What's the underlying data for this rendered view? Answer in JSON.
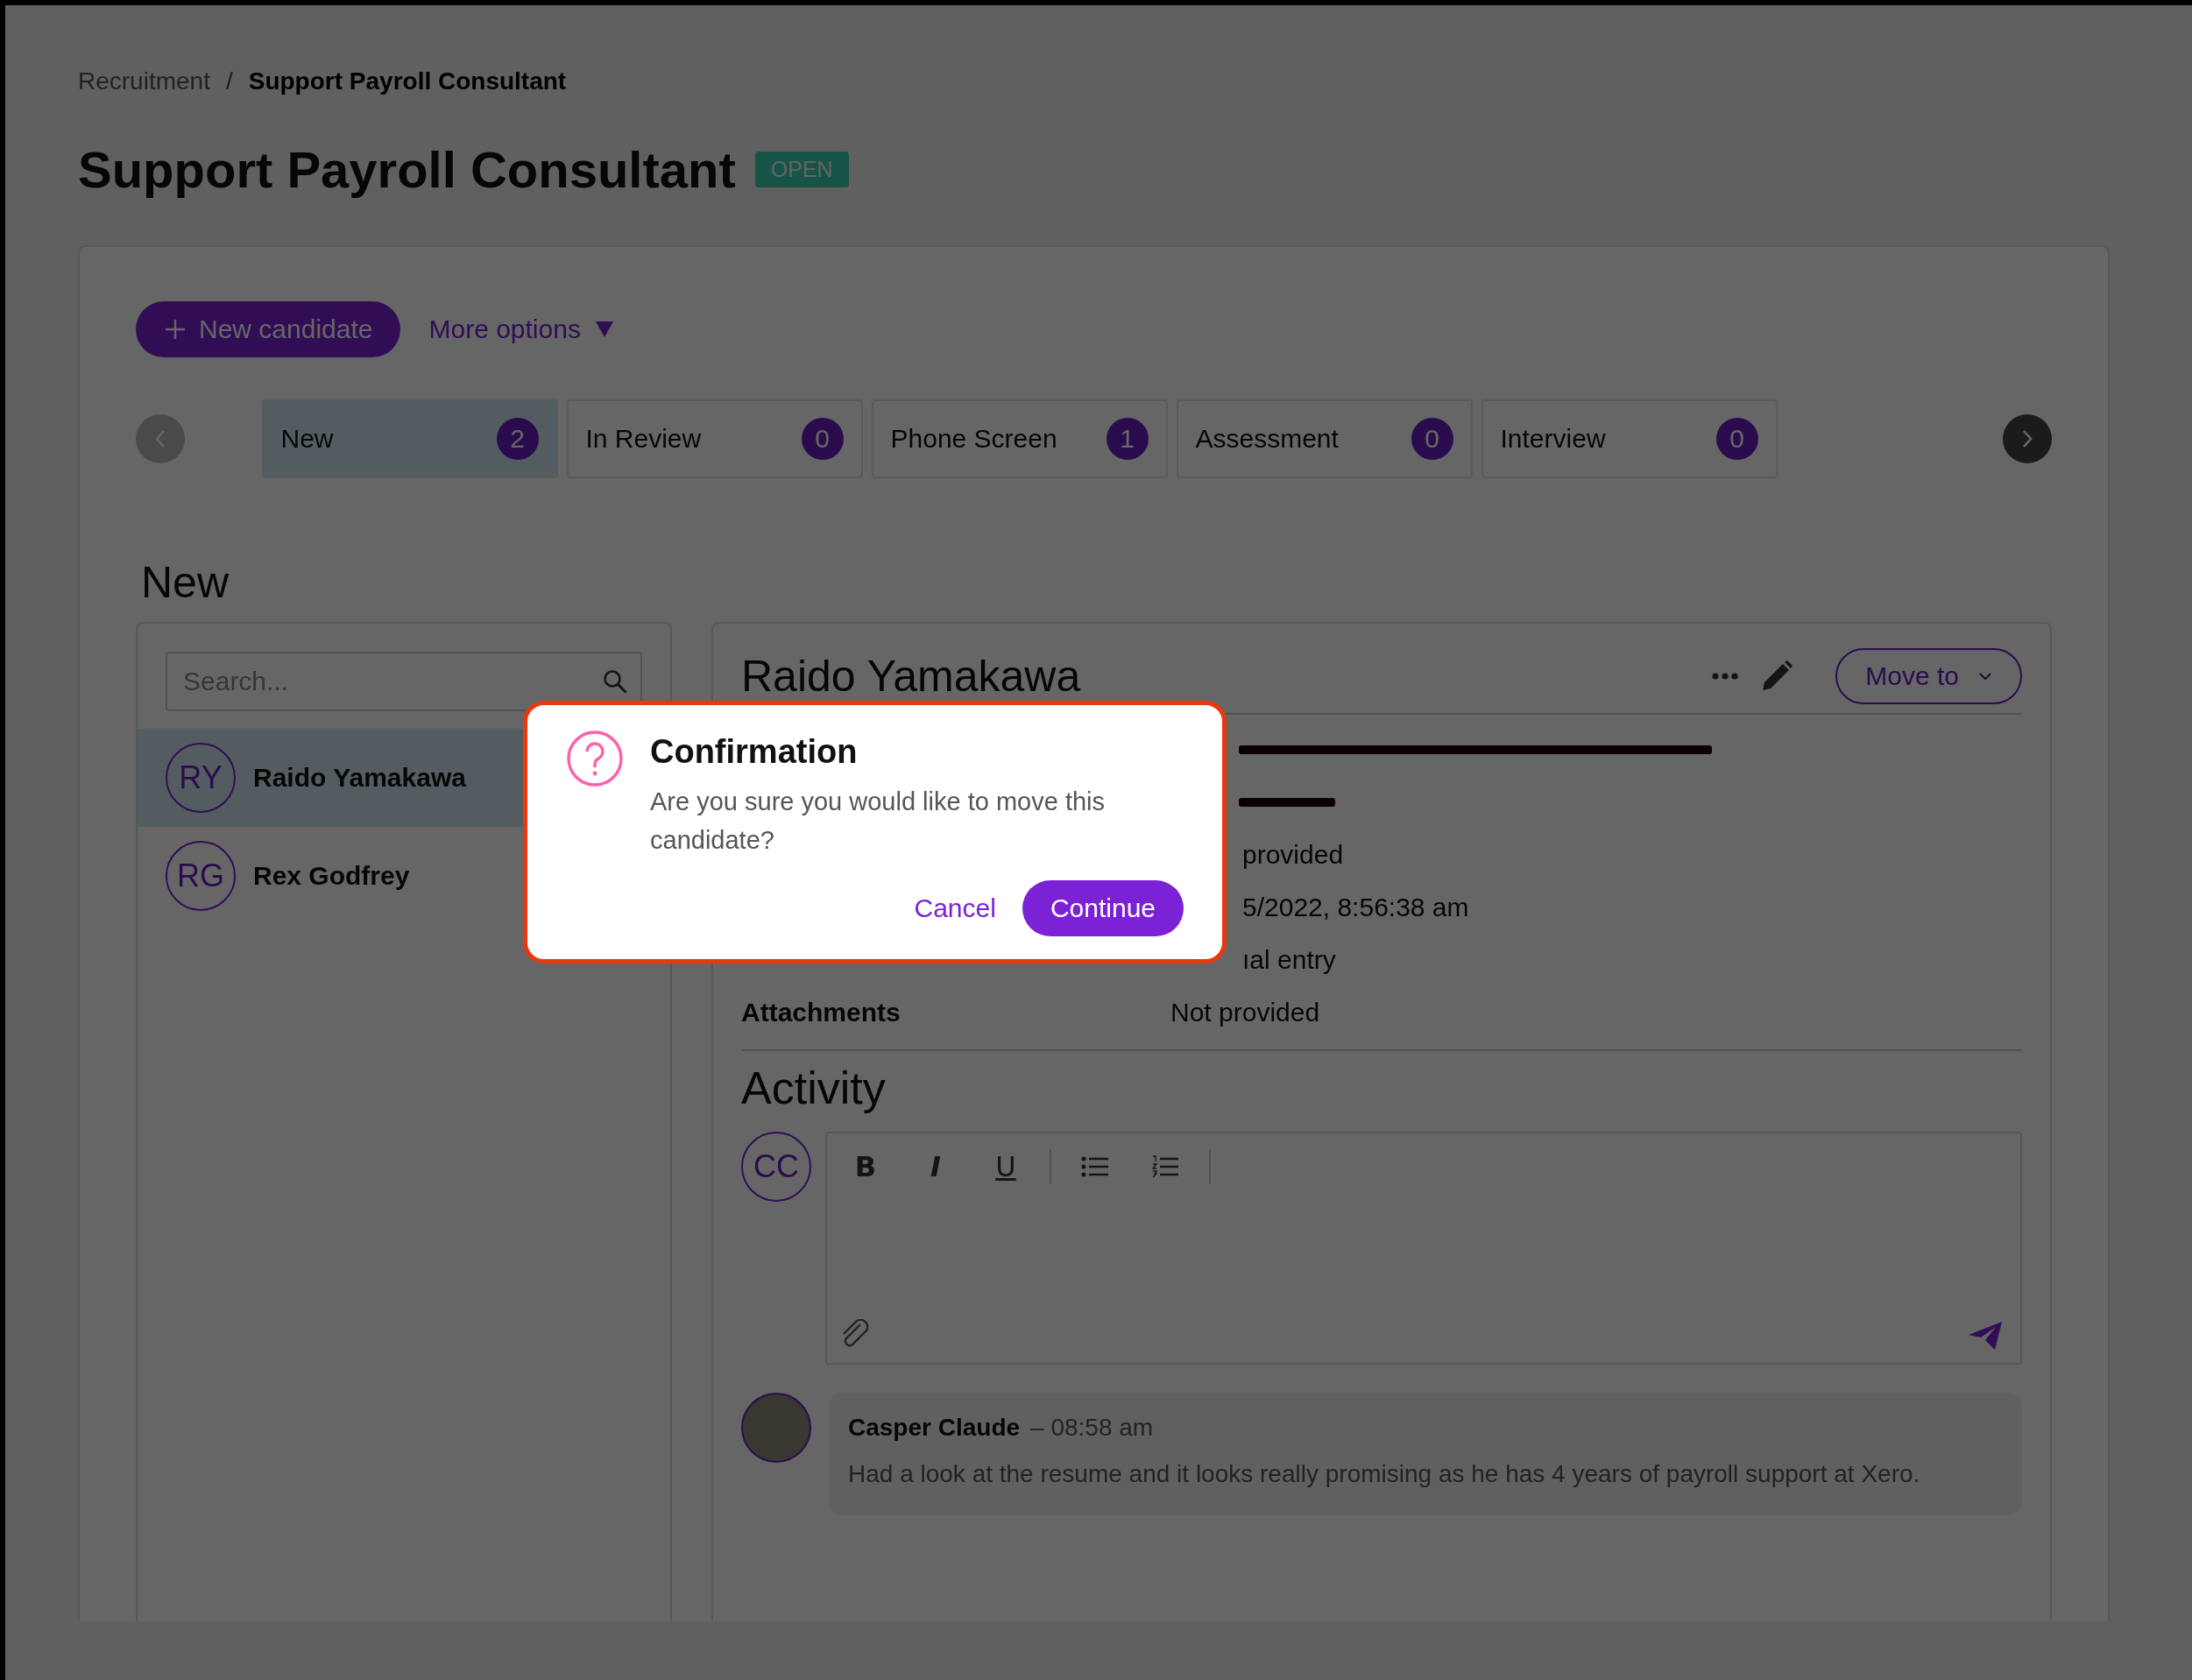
{
  "breadcrumb": [
    {
      "label": "Recruitment",
      "current": false
    },
    {
      "label": "Support Payroll Consultant",
      "current": true
    }
  ],
  "breadcrumb_separator": "/",
  "page": {
    "title": "Support Payroll Consultant",
    "status": "OPEN"
  },
  "toolbar": {
    "primary_button": "New candidate",
    "menu_button": "More options"
  },
  "stages": [
    {
      "label": "New",
      "count": "2",
      "selected": true
    },
    {
      "label": "In Review",
      "count": "0",
      "selected": false
    },
    {
      "label": "Phone Screen",
      "count": "1",
      "selected": false
    },
    {
      "label": "Assessment",
      "count": "0",
      "selected": false
    },
    {
      "label": "Interview",
      "count": "0",
      "selected": false
    }
  ],
  "list": {
    "heading": "New",
    "search_placeholder": "Search...",
    "candidates": [
      {
        "initials": "RY",
        "name": "Raido Yamakawa",
        "selected": true
      },
      {
        "initials": "RG",
        "name": "Rex Godfrey",
        "selected": false
      }
    ]
  },
  "detail": {
    "name": "Raido Yamakawa",
    "move_button": "Move to",
    "fields": [
      {
        "kind": "email"
      },
      {
        "kind": "phone"
      },
      {
        "kind": "covered",
        "value": "provided"
      },
      {
        "kind": "covered",
        "value": "5/2022, 8:56:38 am"
      },
      {
        "kind": "covered",
        "value": "ıal entry"
      },
      {
        "kind": "full",
        "label": "Attachments",
        "value": "Not provided"
      }
    ]
  },
  "activity": {
    "heading": "Activity",
    "composer": {
      "initials": "CC",
      "tools": [
        {
          "kind": "bold",
          "label": "B"
        },
        {
          "kind": "italic",
          "label": "I"
        },
        {
          "kind": "underline",
          "label": "U"
        },
        {
          "kind": "bullets"
        },
        {
          "kind": "numbers"
        }
      ]
    },
    "comments": [
      {
        "author": "Casper Claude",
        "time": "– 08:58 am",
        "text": "Had a look at the resume and it looks really promising as he has 4 years of payroll support at Xero."
      }
    ]
  },
  "dialog": {
    "title": "Confirmation",
    "message": "Are you sure you would like to move this candidate?",
    "cancel": "Cancel",
    "confirm": "Continue"
  }
}
